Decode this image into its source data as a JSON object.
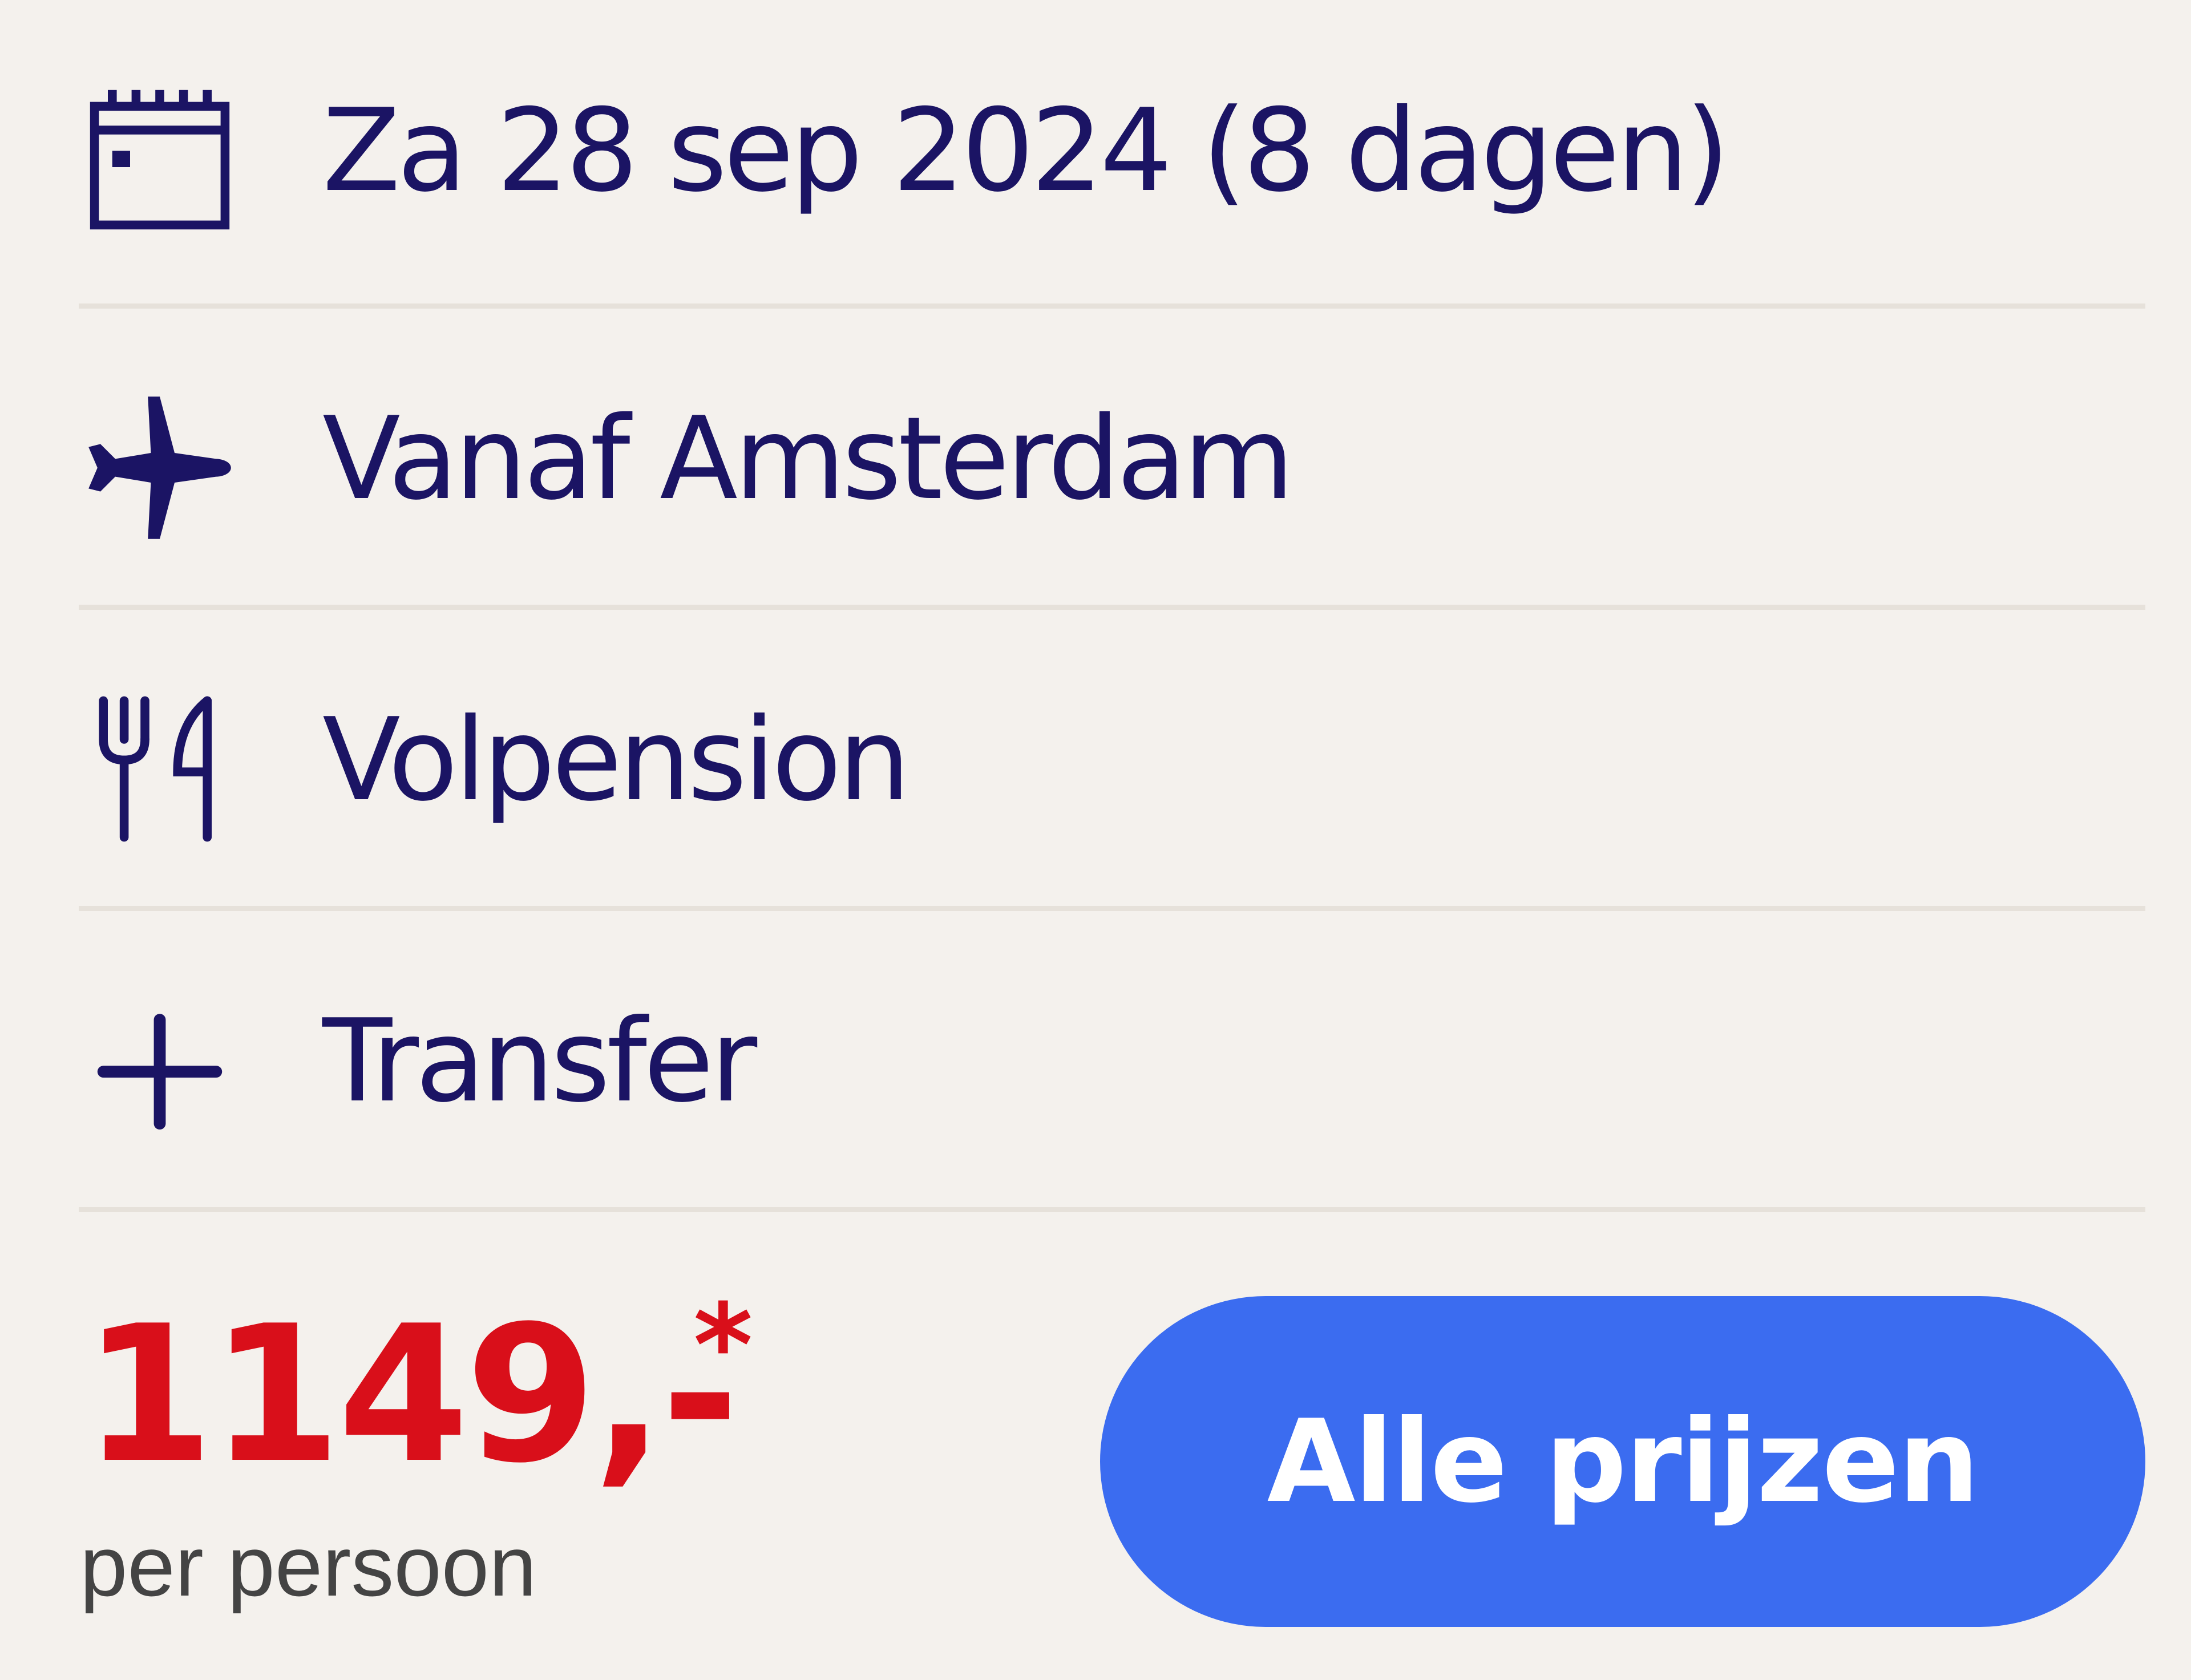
{
  "details": [
    {
      "icon": "calendar-icon",
      "label": "Za 28 sep 2024 (8 dagen)"
    },
    {
      "icon": "airplane-icon",
      "label": "Vanaf Amsterdam"
    },
    {
      "icon": "fork-knife-icon",
      "label": "Volpension"
    },
    {
      "icon": "plus-icon",
      "label": "Transfer"
    }
  ],
  "price": {
    "amount": "1149,-",
    "asterisk": "*",
    "unit": "per persoon"
  },
  "cta": {
    "label": "Alle prijzen"
  },
  "colors": {
    "background": "#f4f1ed",
    "text": "#1b1464",
    "price": "#d90f1a",
    "button": "#3b6cf0",
    "divider": "#e6e1da"
  }
}
